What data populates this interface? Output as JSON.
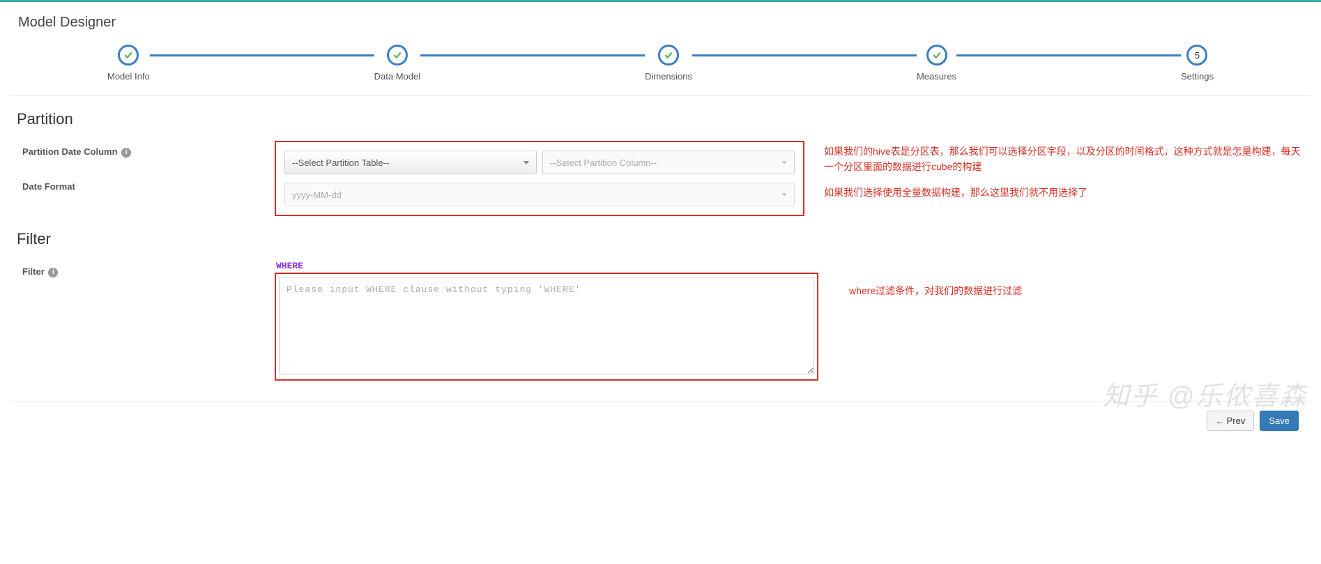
{
  "page": {
    "title": "Model Designer"
  },
  "stepper": {
    "steps": [
      {
        "label": "Model Info",
        "done": true
      },
      {
        "label": "Data Model",
        "done": true
      },
      {
        "label": "Dimensions",
        "done": true
      },
      {
        "label": "Measures",
        "done": true
      },
      {
        "label": "Settings",
        "done": false,
        "num": "5"
      }
    ]
  },
  "partition": {
    "heading": "Partition",
    "date_column_label": "Partition Date Column",
    "date_format_label": "Date Format",
    "select_table_placeholder": "--Select Partition Table--",
    "select_column_placeholder": "--Select Partition Column--",
    "date_format_value": "yyyy-MM-dd"
  },
  "filter": {
    "heading": "Filter",
    "label": "Filter",
    "where_label": "WHERE",
    "where_placeholder": "Please input WHERE clause without typing 'WHERE'"
  },
  "annotations": {
    "partition_p1": "如果我们的hive表是分区表，那么我们可以选择分区字段，以及分区的时间格式，这种方式就是怎量构建，每天一个分区里面的数据进行cube的构建",
    "partition_p2": "如果我们选择使用全量数据构建，那么这里我们就不用选择了",
    "filter_note": "where过滤条件，对我们的数据进行过滤"
  },
  "footer": {
    "prev_label": "Prev",
    "save_label": "Save"
  },
  "watermark": "知乎 @乐侬喜森"
}
